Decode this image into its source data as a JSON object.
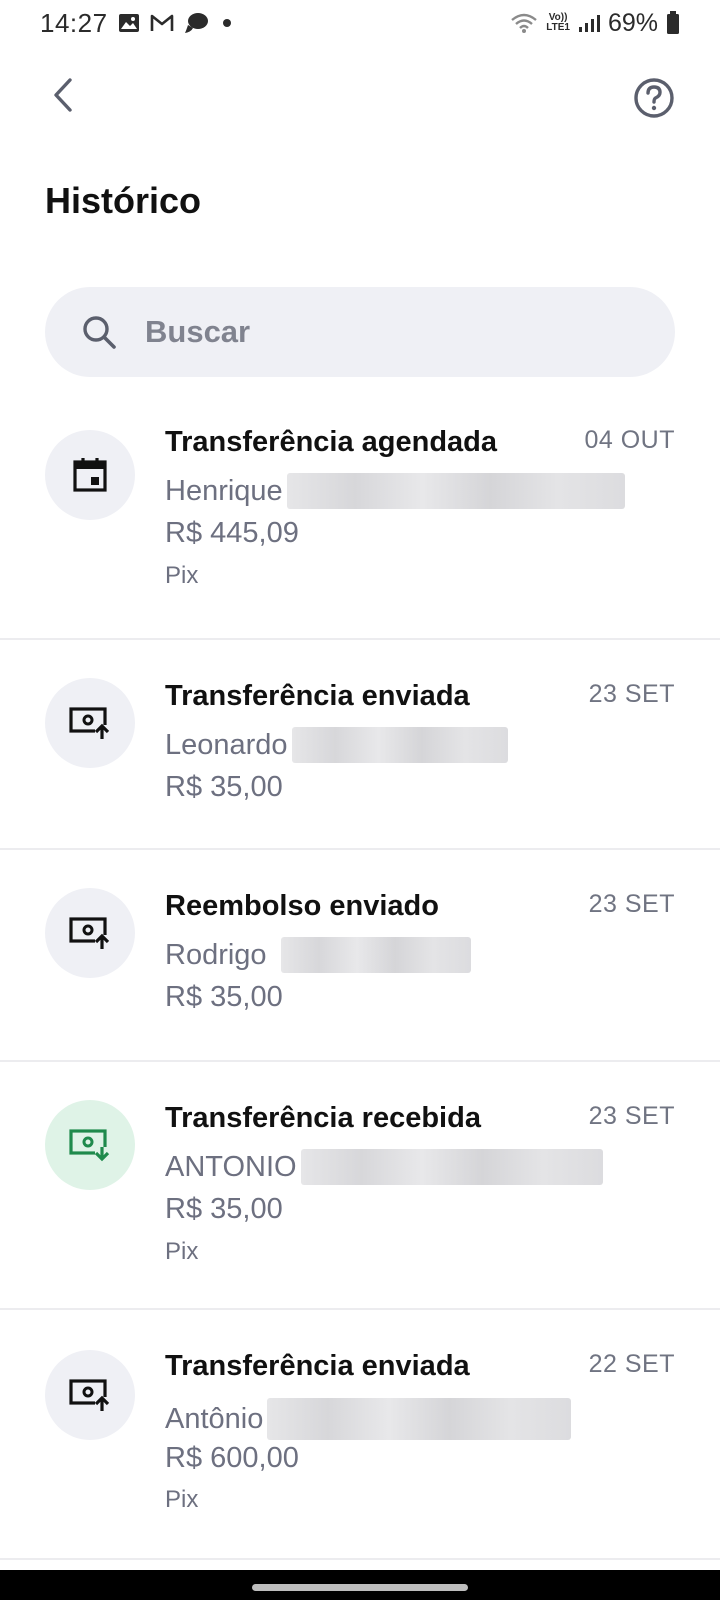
{
  "status_bar": {
    "time": "14:27",
    "battery": "69%",
    "network": "LTE1",
    "volte": "Vo))"
  },
  "app_bar": {
    "back_icon": "chevron-left-icon",
    "help_icon": "help-circle-icon"
  },
  "page": {
    "title": "Histórico"
  },
  "search": {
    "placeholder": "Buscar",
    "value": ""
  },
  "transactions": [
    {
      "icon": "calendar-icon",
      "icon_style": "neutral",
      "title": "Transferência agendada",
      "date": "04 OUT",
      "name": "Henrique",
      "amount": "R$ 445,09",
      "method": "Pix"
    },
    {
      "icon": "money-send-icon",
      "icon_style": "neutral",
      "title": "Transferência enviada",
      "date": "23 SET",
      "name": "Leonardo",
      "amount": "R$ 35,00",
      "method": ""
    },
    {
      "icon": "money-send-icon",
      "icon_style": "neutral",
      "title": "Reembolso enviado",
      "date": "23 SET",
      "name": "Rodrigo",
      "amount": "R$ 35,00",
      "method": ""
    },
    {
      "icon": "money-receive-icon",
      "icon_style": "green",
      "title": "Transferência recebida",
      "date": "23 SET",
      "name": "ANTONIO",
      "amount": "R$ 35,00",
      "method": "Pix"
    },
    {
      "icon": "money-send-icon",
      "icon_style": "neutral",
      "title": "Transferência enviada",
      "date": "22 SET",
      "name": "Antônio",
      "amount": "R$ 600,00",
      "method": "Pix"
    }
  ],
  "colors": {
    "accent_green": "#1f8a4c",
    "green_bg": "#dff3e7",
    "neutral_bg": "#eff0f5",
    "muted_text": "#6d7080"
  }
}
